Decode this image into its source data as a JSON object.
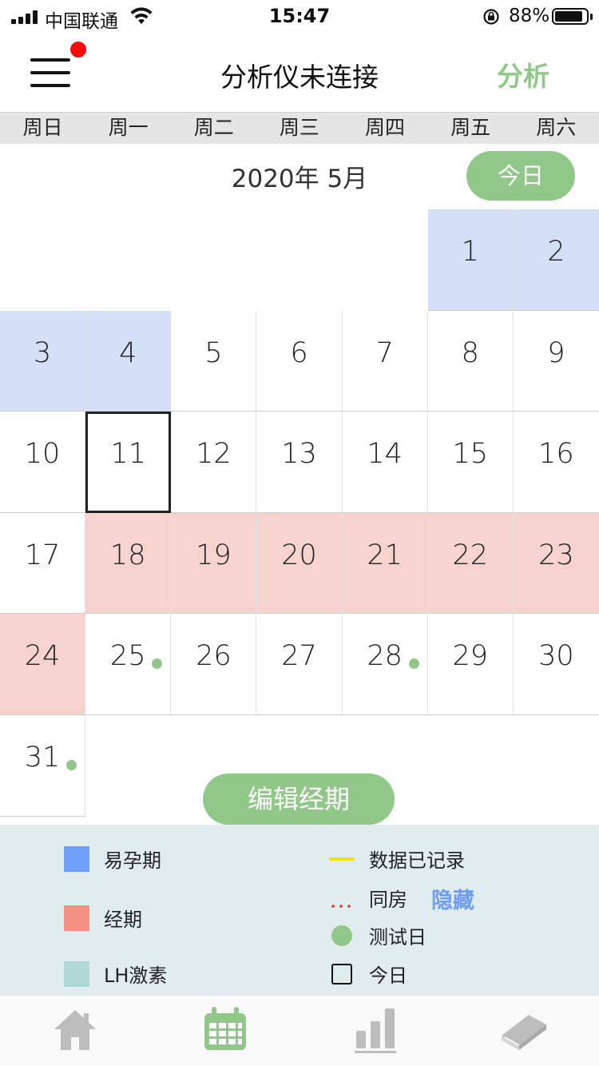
{
  "status_bar": {
    "carrier": "中国联通",
    "time": "15:47",
    "battery": "88%"
  },
  "header": {
    "title": "分析仪未连接",
    "analyze_label": "分析"
  },
  "weekdays": [
    "周日",
    "周一",
    "周二",
    "周三",
    "周四",
    "周五",
    "周六"
  ],
  "month_label": "2020年 5月",
  "today_button": "今日",
  "calendar": {
    "days": [
      {
        "day": "1",
        "type": "fertile"
      },
      {
        "day": "2",
        "type": "fertile"
      },
      {
        "day": "3",
        "type": "fertile"
      },
      {
        "day": "4",
        "type": "fertile"
      },
      {
        "day": "5"
      },
      {
        "day": "6"
      },
      {
        "day": "7"
      },
      {
        "day": "8"
      },
      {
        "day": "9"
      },
      {
        "day": "10"
      },
      {
        "day": "11",
        "today": true
      },
      {
        "day": "12"
      },
      {
        "day": "13"
      },
      {
        "day": "14"
      },
      {
        "day": "15"
      },
      {
        "day": "16"
      },
      {
        "day": "17"
      },
      {
        "day": "18",
        "type": "period"
      },
      {
        "day": "19",
        "type": "period"
      },
      {
        "day": "20",
        "type": "period"
      },
      {
        "day": "21",
        "type": "period"
      },
      {
        "day": "22",
        "type": "period"
      },
      {
        "day": "23",
        "type": "period"
      },
      {
        "day": "24",
        "type": "period"
      },
      {
        "day": "25",
        "test": true
      },
      {
        "day": "26"
      },
      {
        "day": "27"
      },
      {
        "day": "28",
        "test": true
      },
      {
        "day": "29"
      },
      {
        "day": "30"
      },
      {
        "day": "31",
        "test": true
      }
    ]
  },
  "edit_period_button": "编辑经期",
  "legend": {
    "fertile": "易孕期",
    "period": "经期",
    "lh": "LH激素",
    "recorded": "数据已记录",
    "intercourse": "同房",
    "hide": "隐藏",
    "test_day": "测试日",
    "today": "今日"
  },
  "colors": {
    "accent": "#91c88a",
    "fertile": "#d4e0f7",
    "period": "#f7d3cf",
    "legend_fertile": "#6f9ff7",
    "legend_period": "#f39482",
    "legend_lh": "#b0d8d4",
    "legend_recorded": "#f5e013",
    "legend_intercourse": "#e23b1e",
    "hide_link": "#6f9df4"
  },
  "tabs": [
    {
      "name": "home-icon"
    },
    {
      "name": "calendar-icon",
      "active": true
    },
    {
      "name": "chart-icon"
    },
    {
      "name": "book-icon"
    }
  ]
}
